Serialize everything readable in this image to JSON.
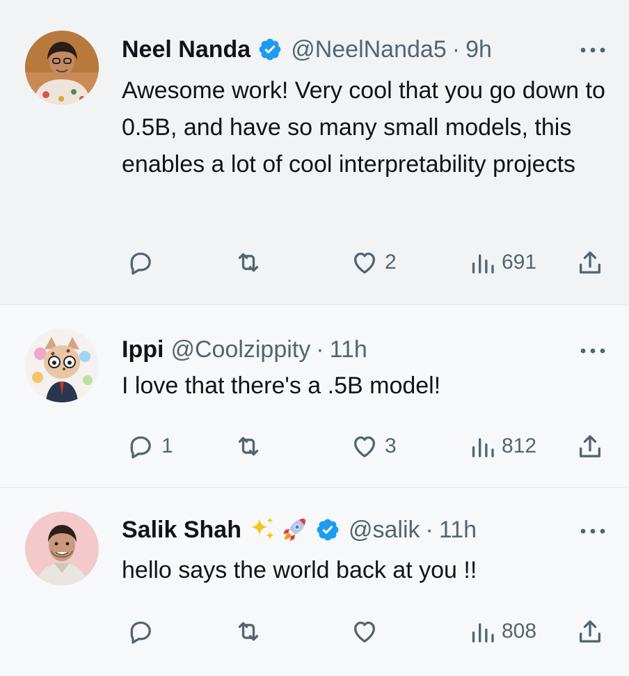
{
  "colors": {
    "verified_blue": "#1d9bf0",
    "text_primary": "#0f1419",
    "text_secondary": "#536471"
  },
  "tweets": [
    {
      "name": "Neel Nanda",
      "verified": true,
      "handle": "@NeelNanda5",
      "separator": "·",
      "time": "9h",
      "text": "Awesome work! Very cool that you go down to 0.5B, and have so many small models, this enables a lot of cool interpretability projects",
      "replies": "",
      "retweets": "",
      "likes": "2",
      "views": "691"
    },
    {
      "name": "Ippi",
      "verified": false,
      "handle": "@Coolzippity",
      "separator": "·",
      "time": "11h",
      "text": "I love that there's a .5B model!",
      "replies": "1",
      "retweets": "",
      "likes": "3",
      "views": "812"
    },
    {
      "name": "Salik Shah",
      "verified": true,
      "emojis": [
        "sparkles-icon",
        "rocket-icon"
      ],
      "handle": "@salik",
      "separator": "·",
      "time": "11h",
      "text": "hello says the world back at you !!",
      "replies": "",
      "retweets": "",
      "likes": "",
      "views": "808"
    }
  ]
}
